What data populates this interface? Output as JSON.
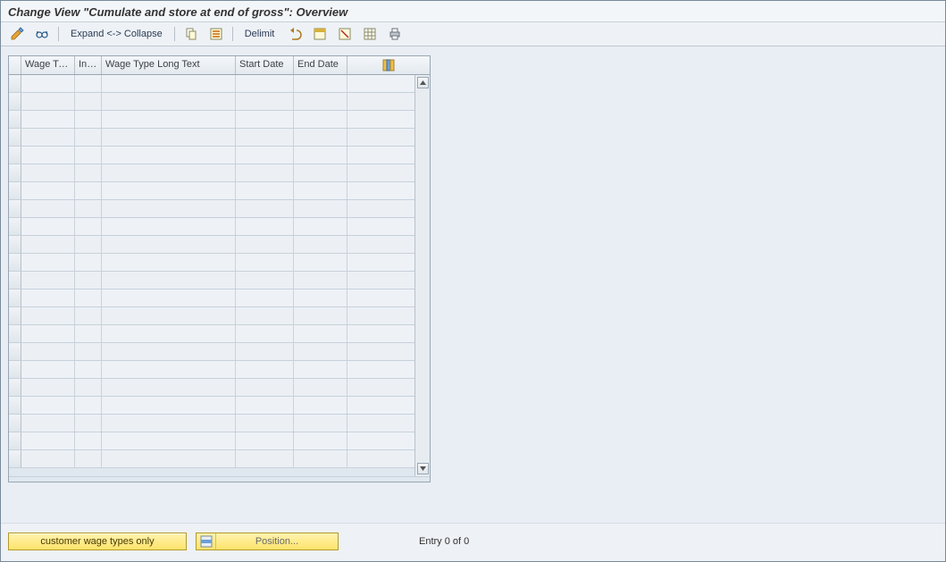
{
  "title": "Change View \"Cumulate and store at end of gross\": Overview",
  "toolbar": {
    "expand_collapse": "Expand <-> Collapse",
    "delimit": "Delimit"
  },
  "columns": {
    "wage_type": "Wage Ty...",
    "inf": "Inf...",
    "long_text": "Wage Type Long Text",
    "start_date": "Start Date",
    "end_date": "End Date"
  },
  "rows": [
    {
      "wage_type": "",
      "inf": "",
      "long_text": "",
      "start_date": "",
      "end_date": ""
    },
    {
      "wage_type": "",
      "inf": "",
      "long_text": "",
      "start_date": "",
      "end_date": ""
    },
    {
      "wage_type": "",
      "inf": "",
      "long_text": "",
      "start_date": "",
      "end_date": ""
    },
    {
      "wage_type": "",
      "inf": "",
      "long_text": "",
      "start_date": "",
      "end_date": ""
    },
    {
      "wage_type": "",
      "inf": "",
      "long_text": "",
      "start_date": "",
      "end_date": ""
    },
    {
      "wage_type": "",
      "inf": "",
      "long_text": "",
      "start_date": "",
      "end_date": ""
    },
    {
      "wage_type": "",
      "inf": "",
      "long_text": "",
      "start_date": "",
      "end_date": ""
    },
    {
      "wage_type": "",
      "inf": "",
      "long_text": "",
      "start_date": "",
      "end_date": ""
    },
    {
      "wage_type": "",
      "inf": "",
      "long_text": "",
      "start_date": "",
      "end_date": ""
    },
    {
      "wage_type": "",
      "inf": "",
      "long_text": "",
      "start_date": "",
      "end_date": ""
    },
    {
      "wage_type": "",
      "inf": "",
      "long_text": "",
      "start_date": "",
      "end_date": ""
    },
    {
      "wage_type": "",
      "inf": "",
      "long_text": "",
      "start_date": "",
      "end_date": ""
    },
    {
      "wage_type": "",
      "inf": "",
      "long_text": "",
      "start_date": "",
      "end_date": ""
    },
    {
      "wage_type": "",
      "inf": "",
      "long_text": "",
      "start_date": "",
      "end_date": ""
    },
    {
      "wage_type": "",
      "inf": "",
      "long_text": "",
      "start_date": "",
      "end_date": ""
    },
    {
      "wage_type": "",
      "inf": "",
      "long_text": "",
      "start_date": "",
      "end_date": ""
    },
    {
      "wage_type": "",
      "inf": "",
      "long_text": "",
      "start_date": "",
      "end_date": ""
    },
    {
      "wage_type": "",
      "inf": "",
      "long_text": "",
      "start_date": "",
      "end_date": ""
    },
    {
      "wage_type": "",
      "inf": "",
      "long_text": "",
      "start_date": "",
      "end_date": ""
    },
    {
      "wage_type": "",
      "inf": "",
      "long_text": "",
      "start_date": "",
      "end_date": ""
    },
    {
      "wage_type": "",
      "inf": "",
      "long_text": "",
      "start_date": "",
      "end_date": ""
    },
    {
      "wage_type": "",
      "inf": "",
      "long_text": "",
      "start_date": "",
      "end_date": ""
    }
  ],
  "footer": {
    "customer_wage_types": "customer wage types only",
    "position": "Position...",
    "entry": "Entry 0 of 0"
  }
}
